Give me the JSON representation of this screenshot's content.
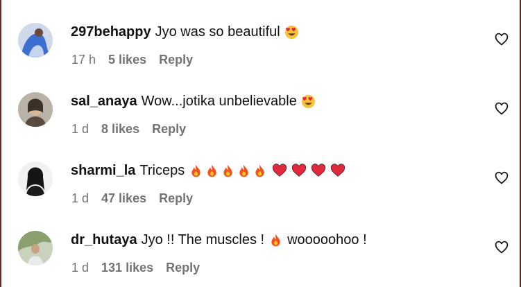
{
  "comments": [
    {
      "username": "297behappy",
      "text": "Jyo was so beautiful",
      "emojis": [
        "heart-eyes"
      ],
      "time": "17 h",
      "likes": "5 likes",
      "reply": "Reply",
      "avatar_color": "#3b6fd1"
    },
    {
      "username": "sal_anaya",
      "text": "Wow...jotika unbelievable",
      "emojis": [
        "heart-eyes"
      ],
      "time": "1 d",
      "likes": "8 likes",
      "reply": "Reply",
      "avatar_color": "#8a7c6c"
    },
    {
      "username": "sharmi_la",
      "text": "Triceps",
      "emojis": [
        "fire",
        "fire",
        "fire",
        "fire",
        "fire",
        "red-heart",
        "red-heart",
        "red-heart",
        "red-heart"
      ],
      "time": "1 d",
      "likes": "47 likes",
      "reply": "Reply",
      "avatar_color": "#222222"
    },
    {
      "username": "dr_hutaya",
      "text": "Jyo !! The muscles !",
      "emojis": [
        "fire"
      ],
      "text_after": "wooooohoo !",
      "time": "1 d",
      "likes": "131 likes",
      "reply": "Reply",
      "avatar_color": "#9aa58a"
    }
  ],
  "colors": {
    "text": "#111111",
    "meta": "#737373",
    "border": "#6b2a22"
  },
  "icons": {
    "like": "heart-outline-icon"
  }
}
